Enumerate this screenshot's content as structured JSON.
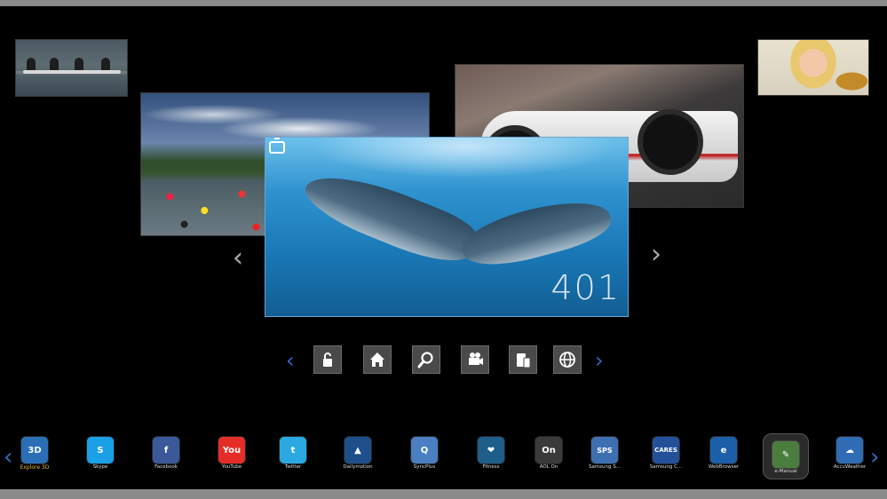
{
  "carousel": {
    "thumbnails": [
      {
        "name": "rowing",
        "description": ""
      },
      {
        "name": "swimmers",
        "description": ""
      },
      {
        "name": "race-car",
        "description": ""
      },
      {
        "name": "girl",
        "description": ""
      }
    ],
    "featured": {
      "channel_number": "401",
      "icon": "tv-icon"
    },
    "prev_glyph": "‹",
    "next_glyph": "›"
  },
  "toolbar": {
    "prev_glyph": "‹",
    "next_glyph": "›",
    "buttons": [
      "lock-icon",
      "home-icon",
      "search-icon",
      "video-camera-icon",
      "mobile-devices-icon",
      "globe-icon"
    ]
  },
  "dock": {
    "prev_glyph": "‹",
    "next_glyph": "›",
    "apps": [
      {
        "label": "Explore 3D",
        "icon_text": "3D",
        "color": "#2a6fb6"
      },
      {
        "label": "Skype",
        "icon_text": "S",
        "color": "#1aa0e6"
      },
      {
        "label": "Facebook",
        "icon_text": "f",
        "color": "#3b5998"
      },
      {
        "label": "YouTube",
        "icon_text": "You",
        "color": "#e52d27"
      },
      {
        "label": "Twitter",
        "icon_text": "t",
        "color": "#2aa9e0"
      },
      {
        "label": "Dailymotion",
        "icon_text": "▲",
        "color": "#1f4f8a"
      },
      {
        "label": "SyncPlus",
        "icon_text": "Q",
        "color": "#4a7fc1"
      },
      {
        "label": "Fitness",
        "icon_text": "❤",
        "color": "#1d5e8b"
      },
      {
        "label": "AOL On",
        "icon_text": "On",
        "color": "#3a3a3a"
      },
      {
        "label": "Samsung S...",
        "icon_text": "SPS",
        "color": "#3e6fb1"
      },
      {
        "label": "Samsung C...",
        "icon_text": "CARES",
        "color": "#24509a"
      },
      {
        "label": "WebBrowser",
        "icon_text": "e",
        "color": "#1c5fa8"
      },
      {
        "label": "e-Manual",
        "icon_text": "✎",
        "color": "#4b7d3e"
      },
      {
        "label": "AccuWeather",
        "icon_text": "☁",
        "color": "#2f6cb3"
      }
    ],
    "selected_index": 12
  }
}
